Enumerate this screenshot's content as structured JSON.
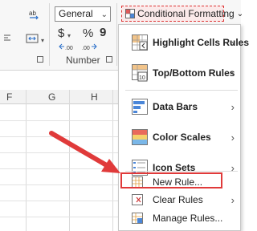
{
  "ribbon": {
    "wrap_text_icon": "wrap-text-icon",
    "merge_icon": "merge-center-icon",
    "number_format_value": "General",
    "currency_symbol": "$",
    "percent_symbol": "%",
    "comma_symbol": "9",
    "number_group_label": "Number",
    "conditional_formatting_label": "Conditional Formatting",
    "conditional_formatting_caret": "⌄"
  },
  "grid": {
    "columns": [
      "F",
      "G",
      "H"
    ]
  },
  "menu": {
    "items": [
      {
        "label": "Highlight Cells Rules",
        "bold": true,
        "icon": "highlight-cells-icon",
        "submenu": true
      },
      {
        "label": "Top/Bottom Rules",
        "bold": true,
        "icon": "top-bottom-icon",
        "submenu": true
      },
      {
        "label": "Data Bars",
        "bold": true,
        "icon": "data-bars-icon",
        "submenu": true
      },
      {
        "label": "Color Scales",
        "bold": true,
        "icon": "color-scales-icon",
        "submenu": true
      },
      {
        "label": "Icon Sets",
        "bold": true,
        "icon": "icon-sets-icon",
        "submenu": true
      },
      {
        "label": "New Rule...",
        "bold": false,
        "icon": "new-rule-icon",
        "submenu": false
      },
      {
        "label": "Clear Rules",
        "bold": false,
        "icon": "clear-rules-icon",
        "submenu": true
      },
      {
        "label": "Manage Rules...",
        "bold": false,
        "icon": "manage-rules-icon",
        "submenu": false
      }
    ],
    "arrow_glyph": "›"
  },
  "annotation": {
    "arrow_color": "#e03a3a",
    "highlight_color": "#e03a3a"
  }
}
